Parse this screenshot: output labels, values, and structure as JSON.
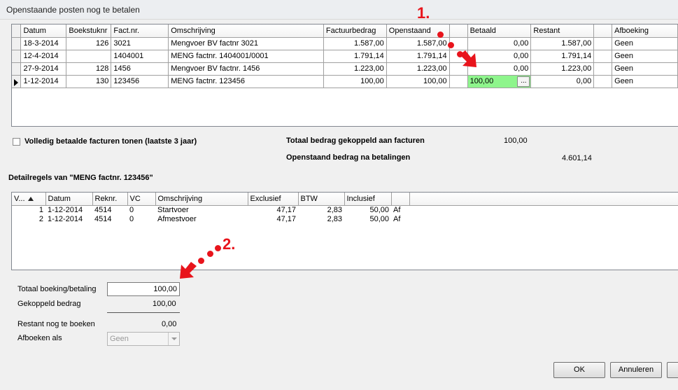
{
  "window": {
    "title": "Openstaande posten nog te betalen"
  },
  "invoices": {
    "columns": [
      "Datum",
      "Boekstuknr",
      "Fact.nr.",
      "Omschrijving",
      "Factuurbedrag",
      "Openstaand",
      "Betaald",
      "Restant",
      "Afboeking"
    ],
    "rows": [
      {
        "datum": "18-3-2014",
        "boekstuknr": "126",
        "factnr": "3021",
        "omschrijving": "Mengvoer BV factnr 3021",
        "factuurbedrag": "1.587,00",
        "openstaand": "1.587,00",
        "betaald": "0,00",
        "restant": "1.587,00",
        "afboeking": "Geen"
      },
      {
        "datum": "12-4-2014",
        "boekstuknr": "",
        "factnr": "1404001",
        "omschrijving": "MENG factnr. 1404001/0001",
        "factuurbedrag": "1.791,14",
        "openstaand": "1.791,14",
        "betaald": "0,00",
        "restant": "1.791,14",
        "afboeking": "Geen"
      },
      {
        "datum": "27-9-2014",
        "boekstuknr": "128",
        "factnr": "1456",
        "omschrijving": "Mengvoer BV  factnr. 1456",
        "factuurbedrag": "1.223,00",
        "openstaand": "1.223,00",
        "betaald": "0,00",
        "restant": "1.223,00",
        "afboeking": "Geen"
      },
      {
        "datum": "1-12-2014",
        "boekstuknr": "130",
        "factnr": "123456",
        "omschrijving": "MENG factnr. 123456",
        "factuurbedrag": "100,00",
        "openstaand": "100,00",
        "betaald": "100,00",
        "restant": "0,00",
        "afboeking": "Geen"
      }
    ],
    "ellipsis_label": "..."
  },
  "options": {
    "show_paid_label": "Volledig betaalde facturen tonen (laatste 3 jaar)",
    "show_paid_checked": false
  },
  "totals": {
    "linked_label": "Totaal bedrag gekoppeld aan facturen",
    "linked_value": "100,00",
    "remaining_label": "Openstaand bedrag na betalingen",
    "remaining_value": "4.601,14"
  },
  "detail": {
    "title": "Detailregels van \"MENG factnr. 123456\"",
    "columns": [
      "V...",
      "Datum",
      "Reknr.",
      "VC",
      "Omschrijving",
      "Exclusief",
      "BTW",
      "Inclusief",
      ""
    ],
    "rows": [
      {
        "v": "1",
        "datum": "1-12-2014",
        "reknr": "4514",
        "vc": "0",
        "omschrijving": "Startvoer",
        "exclusief": "47,17",
        "btw": "2,83",
        "inclusief": "50,00",
        "af": "Af"
      },
      {
        "v": "2",
        "datum": "1-12-2014",
        "reknr": "4514",
        "vc": "0",
        "omschrijving": "Afmestvoer",
        "exclusief": "47,17",
        "btw": "2,83",
        "inclusief": "50,00",
        "af": "Af"
      }
    ]
  },
  "summary": {
    "total_label": "Totaal boeking/betaling",
    "total_value": "100,00",
    "linked_label": "Gekoppeld bedrag",
    "linked_value": "100,00",
    "rest_label": "Restant nog te boeken",
    "rest_value": "0,00",
    "writeoff_label": "Afboeken als",
    "writeoff_value": "Geen"
  },
  "buttons": {
    "ok": "OK",
    "cancel": "Annuleren"
  },
  "annotations": {
    "step1": "1.",
    "step2": "2.",
    "color": "#e8141c"
  }
}
